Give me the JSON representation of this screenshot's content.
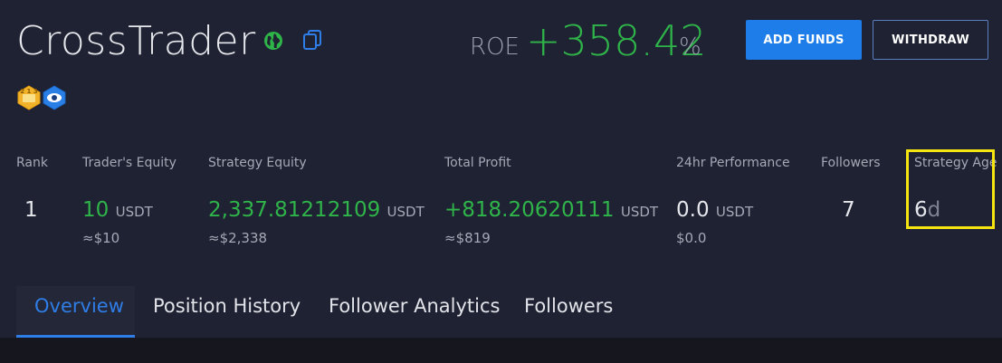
{
  "header": {
    "title": "CrossTrader",
    "globe_icon": "globe-icon",
    "copy_icon": "copy-icon",
    "badges": [
      "trophy-badge-icon",
      "eye-badge-icon"
    ]
  },
  "roe": {
    "label": "ROE",
    "value": "+358.42",
    "unit": "%"
  },
  "actions": {
    "add_funds": "ADD FUNDS",
    "withdraw": "WITHDRAW"
  },
  "stats": {
    "rank": {
      "label": "Rank",
      "value": "1"
    },
    "traders_equity": {
      "label": "Trader's Equity",
      "value": "10",
      "unit": "USDT",
      "approx": "≈$10"
    },
    "strategy_equity": {
      "label": "Strategy Equity",
      "value": "2,337.81212109",
      "unit": "USDT",
      "approx": "≈$2,338"
    },
    "total_profit": {
      "label": "Total Profit",
      "value": "+818.20620111",
      "unit": "USDT",
      "approx": "≈$819"
    },
    "performance_24h": {
      "label": "24hr Performance",
      "value": "0.0",
      "unit": "USDT",
      "approx": "$0.0"
    },
    "followers": {
      "label": "Followers",
      "value": "7"
    },
    "strategy_age": {
      "label": "Strategy Age",
      "value": "6",
      "unit": "d"
    }
  },
  "tabs": [
    {
      "label": "Overview",
      "active": true
    },
    {
      "label": "Position History",
      "active": false
    },
    {
      "label": "Follower Analytics",
      "active": false
    },
    {
      "label": "Followers",
      "active": false
    }
  ],
  "colors": {
    "background": "#1f2232",
    "positive": "#2fb44a",
    "accent": "#1e7de9",
    "highlight": "#f4e510"
  }
}
